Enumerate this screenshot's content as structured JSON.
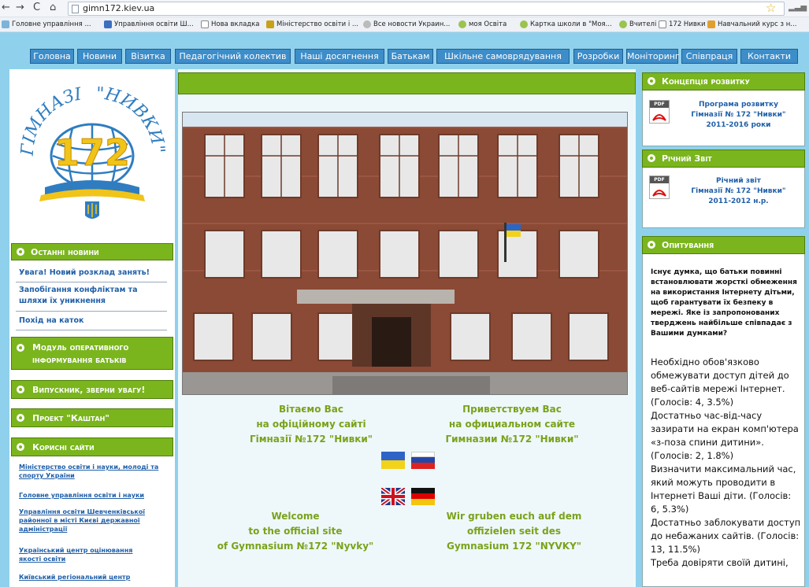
{
  "browser": {
    "url": "gimn172.kiev.ua",
    "bookmarks": [
      "Головне управління ...",
      "Управління освіти Ш...",
      "Нова вкладка",
      "Міністерство освіти і ...",
      "Все новости Украин...",
      "моя Освіта",
      "Картка школи в \"Моя...",
      "Вчителі",
      "172 Нивки",
      "Навчальний курс з н..."
    ]
  },
  "nav": [
    "Головна",
    "Новини",
    "Візитка",
    "Педагогічний колектив",
    "Наші досягнення",
    "Батькам",
    "Шкільне самоврядування",
    "Розробки",
    "Моніторинг",
    "Співпраця",
    "Контакти"
  ],
  "logo": {
    "top_text": "ГІМНАЗІЯ",
    "number": "172",
    "right_text": "\"НИВКИ\""
  },
  "left": {
    "news_title": "Останні новини",
    "news": [
      "Увага! Новий розклад занять!",
      "Запобігання конфліктам та шляхи їх уникнення",
      "Похід на каток"
    ],
    "module": "Модуль оперативного інформування батьків",
    "graduate": "Випускник, зверни увагу!",
    "project": "Проект \"Каштан\"",
    "useful_title": "Корисні сайти",
    "sites": [
      "Міністерство освіти і науки, молоді та спорту України",
      "Головне управління освіти і науки",
      "Управління освіти Шевченківської районної в місті Києві державної адміністрації",
      "Український центр оцінювання якості освіти",
      "Київський регіональний центр"
    ]
  },
  "center": {
    "greet_ua": [
      "Вітаємо Вас",
      "на офіційному сайті",
      "Гімназії №172 \"Нивки\""
    ],
    "greet_ru": [
      "Приветствуем Вас",
      "на официальном сайте",
      "Гимназии №172 \"Нивки\""
    ],
    "greet_en": [
      "Welcome",
      "to the official site",
      "of Gymnasium №172 \"Nyvky\""
    ],
    "greet_de": [
      "Wir gruben euch auf dem",
      "offizielen seit des",
      "Gymnasium 172 \"NYVKY\""
    ]
  },
  "right": {
    "concept_title": "Концепція розвитку",
    "concept_doc": [
      "Програма розвитку",
      "Гімназії № 172 \"Нивки\"",
      "2011-2016 роки"
    ],
    "report_title": "Річний Звіт",
    "report_doc": [
      "Річний звіт",
      "Гімназії № 172 \"Нивки\"",
      "2011-2012 н.р."
    ],
    "poll_title": "Опитування",
    "poll_question": "Існує думка, що батьки повинні встановлювати жорсткі обмеження на використання Інтернету дітьми, щоб гарантувати їх безпеку в мережі. Яке із запропонованих тверджень найбільше співпадає з Вашими думками?",
    "poll_answers": [
      "Необхідно обов'язково обмежувати доступ дітей до веб-сайтів мережі Інтернет. (Голосів: 4, 3.5%)",
      "Достатньо час-від-часу зазирати на екран комп'ютера «з-поза спини дитини». (Голосів: 2, 1.8%)",
      "Визначити максимальний час, який можуть проводити в Інтернеті Ваші діти. (Голосів: 6, 5.3%)",
      "Достатньо заблокувати доступ до небажаних сайтів. (Голосів: 13, 11.5%)",
      "Треба довіряти своїй дитині,"
    ],
    "pdf_label": "PDF"
  }
}
